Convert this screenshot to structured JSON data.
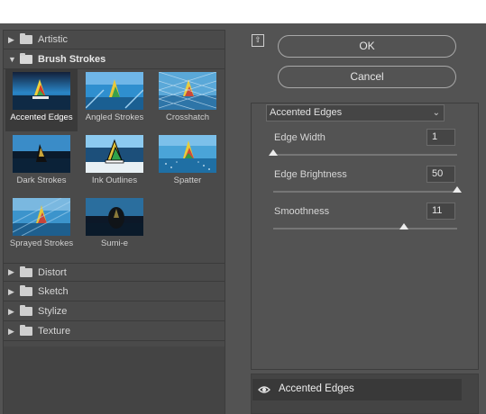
{
  "gallery": {
    "categories_top": [
      {
        "label": "Artistic",
        "state": "collapsed"
      },
      {
        "label": "Brush Strokes",
        "state": "expanded"
      }
    ],
    "thumbnails": [
      {
        "label": "Accented Edges",
        "selected": true
      },
      {
        "label": "Angled Strokes",
        "selected": false
      },
      {
        "label": "Crosshatch",
        "selected": false
      },
      {
        "label": "Dark Strokes",
        "selected": false
      },
      {
        "label": "Ink Outlines",
        "selected": false
      },
      {
        "label": "Spatter",
        "selected": false
      },
      {
        "label": "Sprayed Strokes",
        "selected": false
      },
      {
        "label": "Sumi-e",
        "selected": false
      }
    ],
    "categories_bottom": [
      {
        "label": "Distort"
      },
      {
        "label": "Sketch"
      },
      {
        "label": "Stylize"
      },
      {
        "label": "Texture"
      }
    ]
  },
  "buttons": {
    "ok": "OK",
    "cancel": "Cancel"
  },
  "filter_select": {
    "value": "Accented Edges"
  },
  "params": {
    "edge_width": {
      "label": "Edge Width",
      "value": "1",
      "fraction": 0.0
    },
    "edge_brightness": {
      "label": "Edge Brightness",
      "value": "50",
      "fraction": 1.0
    },
    "smoothness": {
      "label": "Smoothness",
      "value": "11",
      "fraction": 0.71
    }
  },
  "effect_layers": [
    {
      "name": "Accented Edges",
      "visible": true
    }
  ],
  "icons": {
    "collapse": "collapse-panel-icon",
    "eye": "eye-icon",
    "folder": "folder-icon"
  },
  "colors": {
    "dialog_bg": "#535353",
    "selected_cell": "#3a3a3a",
    "knob": "#ececec"
  }
}
